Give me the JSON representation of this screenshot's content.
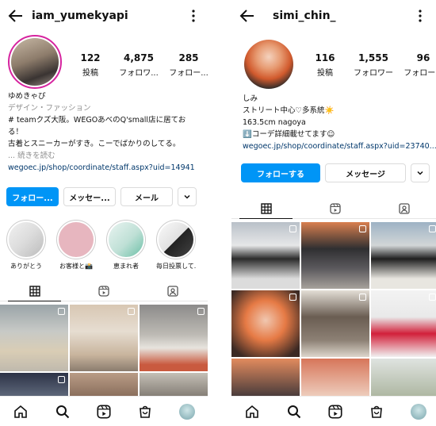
{
  "left": {
    "username": "iam_yumekyapi",
    "stats": [
      {
        "value": "122",
        "label": "投稿"
      },
      {
        "value": "4,875",
        "label": "フォロワ..."
      },
      {
        "value": "285",
        "label": "フォロー..."
      }
    ],
    "bio": {
      "name": "ゆめきゃぴ",
      "category": "デザイン・ファッション",
      "line1": "# teamクズ大阪。WEGOあべのQ'small店に居てお",
      "line2": "る！",
      "line3": "古着とスニーカーがすき。こーでばかりのしてる。",
      "more": "... 続きを読む",
      "link": "wegoec.jp/shop/coordinate/staff.aspx?uid=14941"
    },
    "buttons": {
      "follow": "フォロー...",
      "message": "メッセー...",
      "email": "メール"
    },
    "highlights": [
      {
        "label": "ありがとう"
      },
      {
        "label": "お客様と📸"
      },
      {
        "label": "恵まれ者"
      },
      {
        "label": "毎日投票して..."
      }
    ]
  },
  "right": {
    "username": "simi_chin_",
    "stats": [
      {
        "value": "116",
        "label": "投稿"
      },
      {
        "value": "1,555",
        "label": "フォロワー"
      },
      {
        "value": "96",
        "label": "フォロー..."
      }
    ],
    "bio": {
      "name": "しみ",
      "line1": "ストリート中心♡多系統☀️",
      "line2": "163.5cm nagoya",
      "line3": "⬇️コーデ詳細載せてます☺︎",
      "link": "wegoec.jp/shop/coordinate/staff.aspx?uid=23740..."
    },
    "buttons": {
      "follow": "フォローする",
      "message": "メッセージ"
    }
  },
  "colors": {
    "accent": "#0095f6",
    "link": "#00376b",
    "muted": "#8e8e8e"
  }
}
